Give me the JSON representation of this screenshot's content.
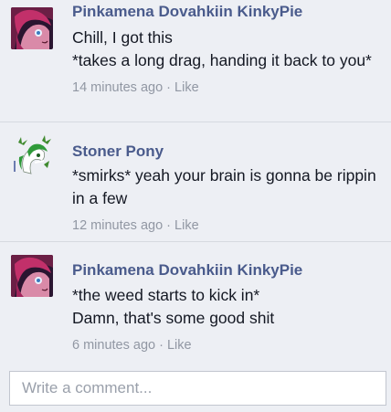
{
  "comments": [
    {
      "avatar_icon": "pinkamena-pony-avatar-icon",
      "author": "Pinkamena Dovahkiin KinkyPie",
      "lines": [
        "Chill, I got this",
        "*takes a long drag, handing it back to you*"
      ],
      "time": "14 minutes ago",
      "separator": " · ",
      "like_label": "Like"
    },
    {
      "avatar_icon": "stoner-pony-avatar-icon",
      "author": "Stoner Pony",
      "lines": [
        "*smirks* yeah your brain is gonna be rippin in a few"
      ],
      "time": "12 minutes ago",
      "separator": " · ",
      "like_label": "Like"
    },
    {
      "avatar_icon": "pinkamena-pony-avatar-icon",
      "author": "Pinkamena Dovahkiin KinkyPie",
      "lines": [
        "*the weed starts to kick in*",
        "Damn, that's some good shit"
      ],
      "time": "6 minutes ago",
      "separator": " · ",
      "like_label": "Like"
    }
  ],
  "composer": {
    "placeholder": "Write a comment..."
  },
  "colors": {
    "background": "#edeff4",
    "author_link": "#4a5b8c",
    "body_text": "#141823",
    "meta_text": "#9197a3",
    "placeholder_text": "#9aa0ab"
  }
}
